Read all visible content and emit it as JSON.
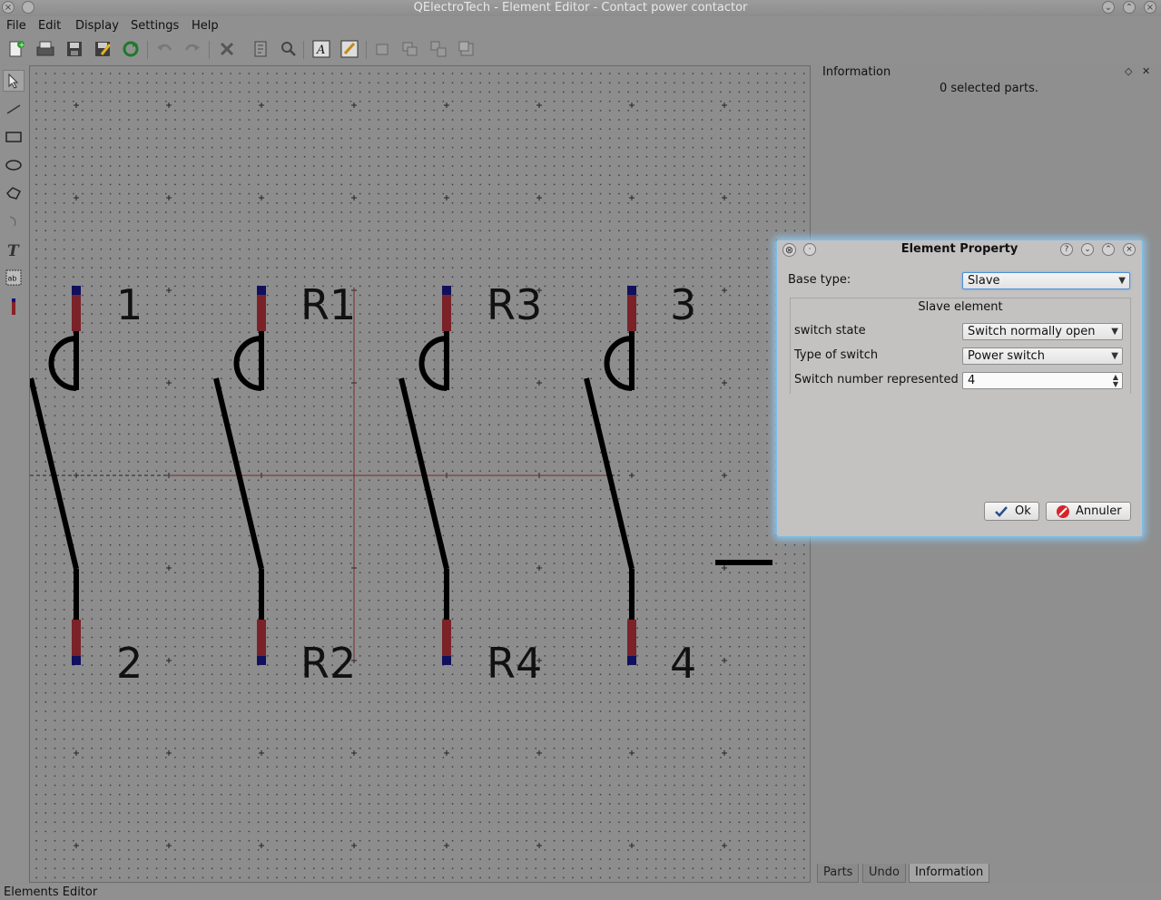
{
  "window": {
    "title": "QElectroTech - Element Editor - Contact power contactor"
  },
  "menu": {
    "items": [
      "File",
      "Edit",
      "Display",
      "Settings",
      "Help"
    ]
  },
  "toolbar": {
    "icons": [
      "new-icon",
      "open-icon",
      "save-icon",
      "save-as-icon",
      "reload-icon",
      "undo-icon",
      "redo-icon",
      "delete-icon",
      "properties-icon",
      "zoom-icon",
      "text-tool-icon",
      "edit-icon",
      "raise-icon",
      "lower-icon",
      "bring-forward-icon",
      "send-backward-icon"
    ]
  },
  "tools": {
    "icons": [
      "select-icon",
      "line-icon",
      "rectangle-icon",
      "ellipse-icon",
      "polygon-icon",
      "arc-icon",
      "text-icon",
      "dynamic-text-icon",
      "terminal-icon"
    ]
  },
  "canvas": {
    "labels": [
      "1",
      "R1",
      "R3",
      "3",
      "2",
      "R2",
      "R4",
      "4"
    ]
  },
  "dock": {
    "title": "Information",
    "status": "0 selected parts.",
    "tabs": [
      "Parts",
      "Undo",
      "Information"
    ],
    "active_tab": "Information"
  },
  "statusbar": {
    "text": "Elements Editor"
  },
  "dialog": {
    "title": "Element Property",
    "base_type_label": "Base type:",
    "base_type_value": "Slave",
    "group_title": "Slave element",
    "switch_state_label": "switch state",
    "switch_state_value": "Switch normally open",
    "switch_type_label": "Type of switch",
    "switch_type_value": "Power switch",
    "switch_number_label": "Switch number represented",
    "switch_number_value": "4",
    "ok_label": "Ok",
    "cancel_label": "Annuler"
  },
  "colors": {
    "accent": "#4a90d9",
    "terminal_red": "#7a2228",
    "terminal_blue": "#10105e",
    "axis": "#7a2a2a"
  }
}
